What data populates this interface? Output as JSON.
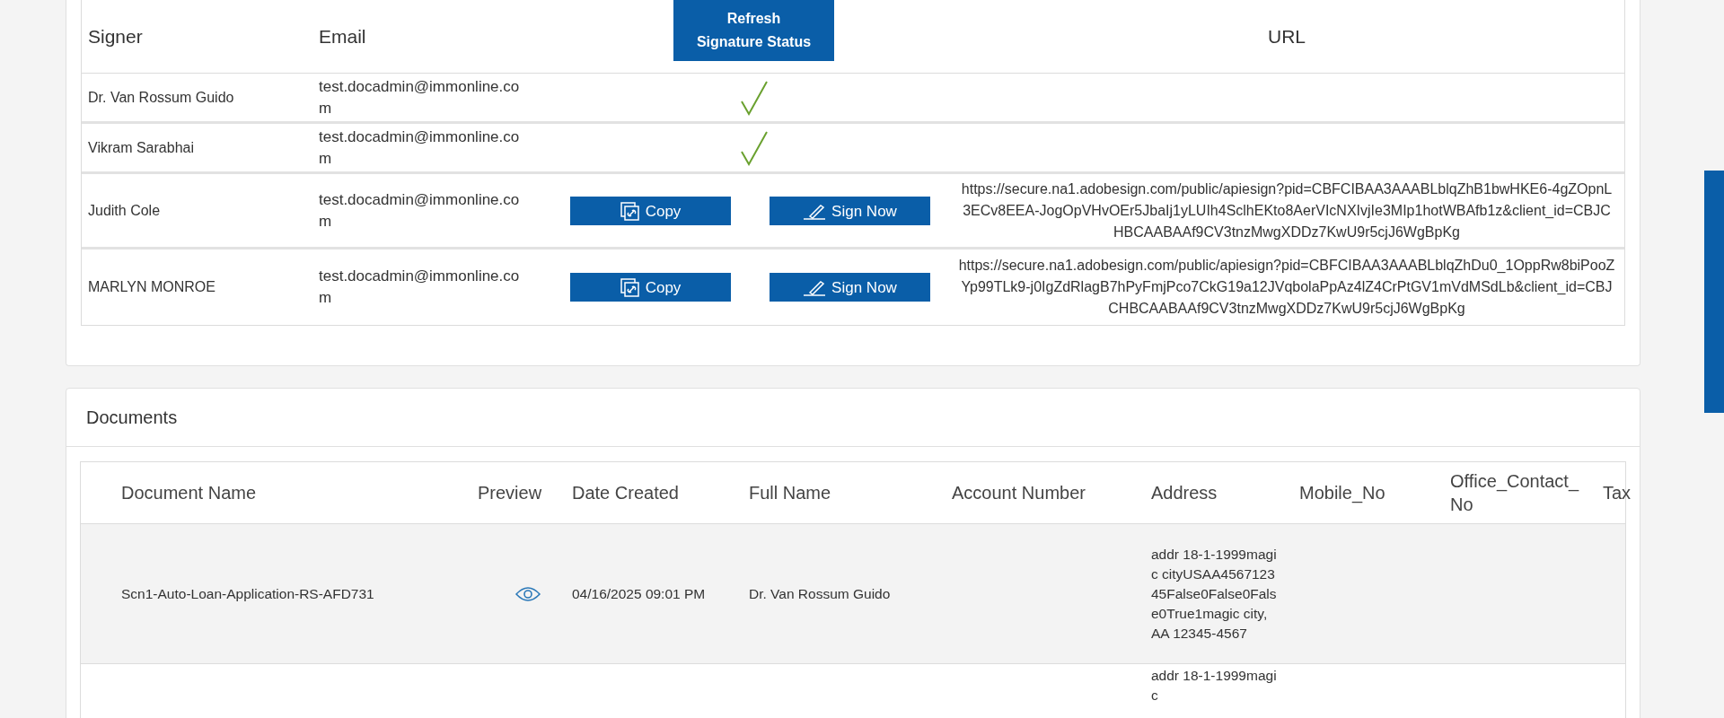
{
  "signers_table": {
    "columns": [
      "Signer",
      "Email",
      "Refresh\nSignature Status",
      "URL"
    ],
    "rows": [
      {
        "signer": "Dr. Van Rossum Guido",
        "email": "test.docadmin@immonline.com",
        "signed": true
      },
      {
        "signer": "Vikram Sarabhai",
        "email": "test.docadmin@immonline.com",
        "signed": true
      },
      {
        "signer": "Judith Cole",
        "email": "test.docadmin@immonline.com",
        "signed": false,
        "copy_label": "Copy",
        "sign_label": "Sign Now",
        "url": "https://secure.na1.adobesign.com/public/apiesign?pid=CBFCIBAA3AAABLblqZhB1bwHKE6-4gZOpnL3ECv8EEA-JogOpVHvOEr5JbaIj1yLUIh4SclhEKto8AerVIcNXIvjIe3MIp1hotWBAfb1z&client_id=CBJCHBCAABAAf9CV3tnzMwgXDDz7KwU9r5cjJ6WgBpKg"
      },
      {
        "signer": "MARLYN MONROE",
        "email": "test.docadmin@immonline.com",
        "signed": false,
        "copy_label": "Copy",
        "sign_label": "Sign Now",
        "url": "https://secure.na1.adobesign.com/public/apiesign?pid=CBFCIBAA3AAABLblqZhDu0_1OppRw8biPooZYp99TLk9-j0IgZdRlagB7hPyFmjPco7CkG19a12JVqbolaPpAz4lZ4CrPtGV1mVdMSdLb&client_id=CBJCHBCAABAAf9CV3tnzMwgXDDz7KwU9r5cjJ6WgBpKg"
      }
    ]
  },
  "documents": {
    "title": "Documents",
    "columns": [
      "Document Name",
      "Preview",
      "Date Created",
      "Full Name",
      "Account Number",
      "Address",
      "Mobile_No",
      "Office_Contact_No",
      "Tax"
    ],
    "rows": [
      {
        "document_name": "Scn1-Auto-Loan-Application-RS-AFD731",
        "preview": true,
        "date_created": "04/16/2025 09:01 PM",
        "full_name": "Dr. Van Rossum Guido",
        "address": "addr 18-1-1999magic cityUSAA456712345False0False0False0True1magic city, AA 12345-4567"
      },
      {
        "address": "addr 18-1-1999magic"
      }
    ]
  }
}
